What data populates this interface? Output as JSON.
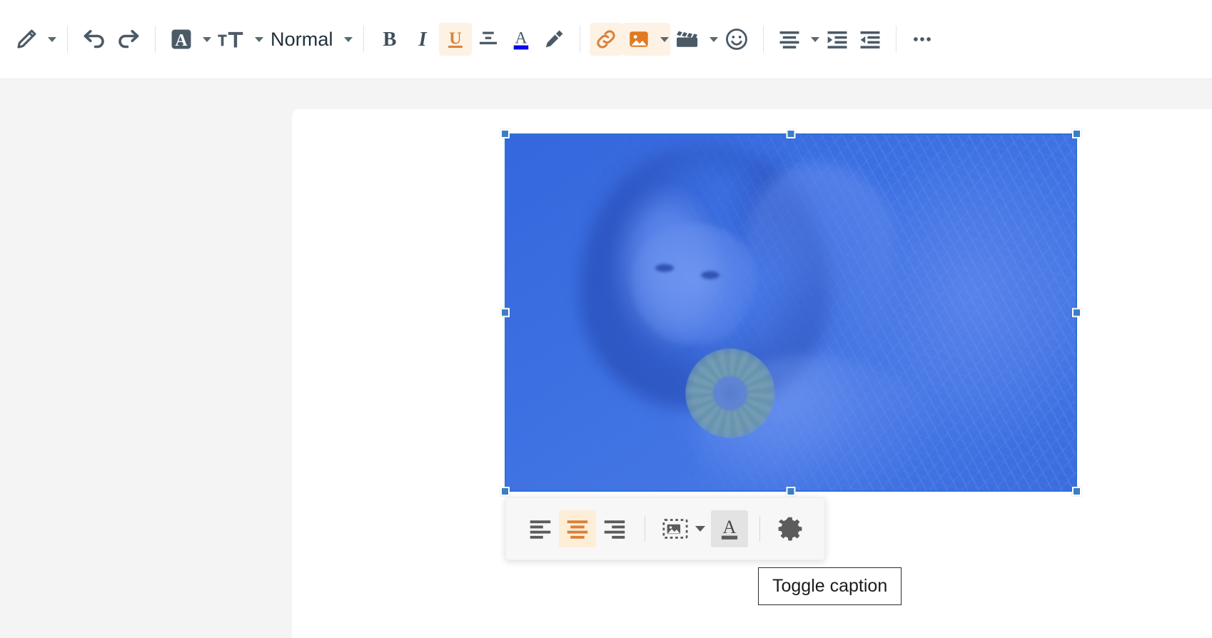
{
  "toolbar": {
    "groups": [
      {
        "items": [
          {
            "name": "pen-icon",
            "label": "Pen",
            "has_caret": true,
            "state": "default"
          }
        ]
      },
      {
        "items": [
          {
            "name": "undo-icon",
            "label": "Undo",
            "has_caret": false,
            "state": "default"
          },
          {
            "name": "redo-icon",
            "label": "Redo",
            "has_caret": false,
            "state": "default"
          }
        ]
      },
      {
        "items": [
          {
            "name": "font-family-icon",
            "label": "Font Family",
            "has_caret": true,
            "state": "default"
          },
          {
            "name": "font-size-icon",
            "label": "Font Size",
            "has_caret": true,
            "state": "default"
          }
        ]
      }
    ],
    "paragraph_style": "Normal",
    "bold_label": "Bold",
    "italic_label": "Italic",
    "underline_label": "Underline",
    "strikethrough_label": "Strikethrough",
    "font_color_label": "Font Color",
    "highlight_label": "Highlight",
    "link_label": "Link",
    "image_label": "Image",
    "media_label": "Media",
    "emoji_label": "Emoji",
    "align_label": "Text alignment",
    "indent_label": "Increase indent",
    "outdent_label": "Decrease indent",
    "more_label": "Show more items",
    "active_items": [
      "underline",
      "link",
      "image"
    ],
    "font_color_swatch": "#0000ee",
    "accent_active_bg": "#fdf2e4",
    "accent_active_fg": "#d9813a",
    "icon_color": "#4c5a66"
  },
  "editor": {
    "background_color": "#f4f4f4",
    "page_background": "#ffffff"
  },
  "image_widget": {
    "state": "selected",
    "selection_tint": "#2a5ee8",
    "handle_color": "#3a7fc4",
    "handles": [
      "top-left",
      "top-middle",
      "top-right",
      "middle-left",
      "middle-right",
      "bottom-left",
      "bottom-middle",
      "bottom-right"
    ],
    "alt_text": "Woman lying in grass holding a sunflower"
  },
  "balloon_toolbar": {
    "buttons": [
      {
        "name": "align-left-button",
        "label": "Align left",
        "state": "default"
      },
      {
        "name": "align-center-button",
        "label": "Align center",
        "state": "active-orange"
      },
      {
        "name": "align-right-button",
        "label": "Align right",
        "state": "default"
      },
      {
        "name": "resize-image-button",
        "label": "Resize image",
        "state": "default",
        "has_caret": true
      },
      {
        "name": "toggle-caption-button",
        "label": "Toggle caption",
        "state": "active-gray"
      },
      {
        "name": "image-settings-button",
        "label": "Image settings",
        "state": "default"
      }
    ]
  },
  "tooltip": {
    "text": "Toggle caption",
    "visible": true
  }
}
